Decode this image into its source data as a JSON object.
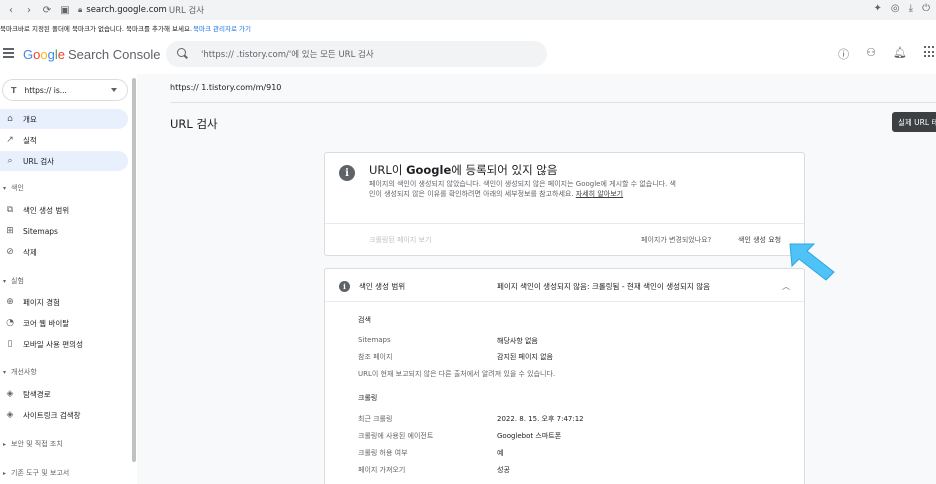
{
  "browser": {
    "url_host": "search.google.com",
    "url_rest": "URL 검사",
    "bookmark_text": "북마크바로 지정된 폴더에 북마크가 없습니다. 북마크를 추가해 보세요.",
    "bookmark_link": "북마크 관리자로 가기"
  },
  "header": {
    "logo_google": [
      "G",
      "o",
      "o",
      "g",
      "l",
      "e"
    ],
    "logo_product": "Search Console",
    "search_placeholder": "'https://        .tistory.com/'에 있는 모든 URL 검사"
  },
  "sidebar": {
    "property_icon": "T",
    "property_value": "https://        is...",
    "items": [
      {
        "label": "개요",
        "icon": "home-icon",
        "active": true
      },
      {
        "label": "실적",
        "icon": "trending-icon",
        "active": false
      },
      {
        "label": "URL 검사",
        "icon": "search-icon",
        "active": true
      }
    ],
    "section_index": "색인",
    "index_items": [
      {
        "label": "색인 생성 범위",
        "icon": "coverage-icon"
      },
      {
        "label": "Sitemaps",
        "icon": "sitemap-icon"
      },
      {
        "label": "삭제",
        "icon": "removals-icon"
      }
    ],
    "section_experience": "실험",
    "experience_items": [
      {
        "label": "페이지 경험",
        "icon": "page-experience-icon"
      },
      {
        "label": "코어 웹 바이탈",
        "icon": "speed-icon"
      },
      {
        "label": "모바일 사용 편의성",
        "icon": "mobile-icon"
      }
    ],
    "section_enhancements": "개선사항",
    "enhancement_items": [
      {
        "label": "탐색경로",
        "icon": "layers-icon"
      },
      {
        "label": "사이트링크 검색창",
        "icon": "layers-icon"
      }
    ],
    "section_security": "보안 및 직접 조치",
    "section_legacy": "기존 도구 및 보고서"
  },
  "main": {
    "breadcrumb": "https://        1.tistory.com/m/910",
    "title": "URL 검사",
    "live_test_button": "실제 URL 테스트"
  },
  "status_card": {
    "heading_pre": "URL이 ",
    "heading_bold": "Google",
    "heading_post": "에 등록되어 있지 않음",
    "description": "페이지의 색인이 생성되지 않았습니다. 색인이 생성되지 않은 페이지는 Google에 게시할 수 없습니다. 색인이 생성되지 않은 이유를 확인하려면 아래의 세부정보를 참고하세요.",
    "learn_more": "자세히 알아보기",
    "crawled_page": "크롤링된 페이지 보기",
    "changed_question": "페이지가 변경되었나요?",
    "request_indexing": "색인 생성 요청"
  },
  "coverage_card": {
    "title": "색인 생성 범위",
    "status": "페이지 색인이 생성되지 않음: 크롤링됨 - 현재 색인이 생성되지 않음",
    "discovery_heading": "검색",
    "sitemaps_label": "Sitemaps",
    "sitemaps_value": "해당사항 없음",
    "referring_label": "참조 페이지",
    "referring_value": "감지된 페이지 없음",
    "discovery_note": "URL이 현재 보고되지 않은 다른 출처에서 알려져 있을 수 있습니다.",
    "crawl_heading": "크롤링",
    "last_crawl_label": "최근 크롤링",
    "last_crawl_value": "2022. 8. 15. 오후 7:47:12",
    "crawled_as_label": "크롤링에 사용된 에이전트",
    "crawled_as_value": "Googlebot 스마트폰",
    "crawl_allowed_label": "크롤링 허용 여부",
    "crawl_allowed_value": "예",
    "page_fetch_label": "페이지 가져오기",
    "page_fetch_value": "성공"
  },
  "colors": {
    "accent_blue": "#1a73e8",
    "active_nav": "#e8f0fe",
    "arrow": "#4fc3f7"
  }
}
